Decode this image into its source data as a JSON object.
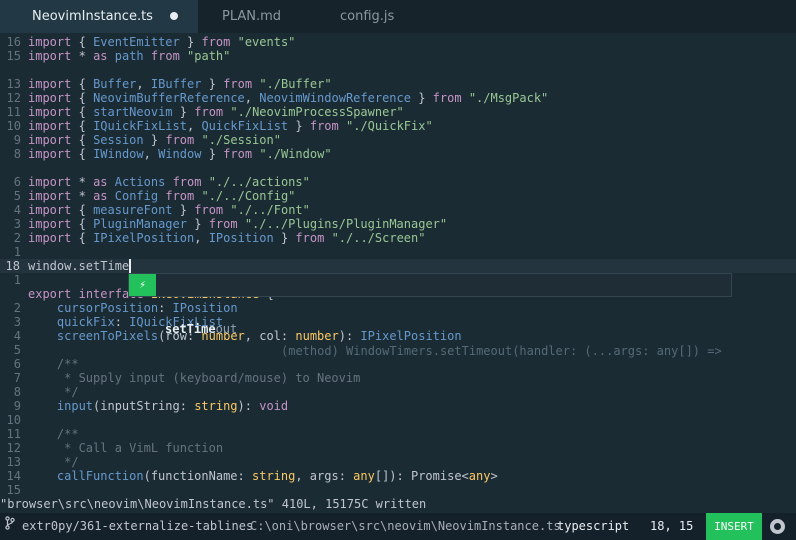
{
  "tabs": [
    {
      "label": "NeovimInstance.ts",
      "modified": true,
      "active": true
    },
    {
      "label": "PLAN.md"
    },
    {
      "label": "config.js"
    }
  ],
  "gutter": [
    "16",
    "15",
    "",
    "13",
    "12",
    "11",
    "10",
    "9",
    "8",
    "",
    "6",
    "5",
    "4",
    "3",
    "2",
    "1",
    "",
    "18",
    "1",
    "2",
    "3",
    "4",
    "5",
    "6",
    "7",
    "8",
    "9",
    "10",
    "11",
    "12",
    "13",
    "14",
    "15",
    "16"
  ],
  "code": {
    "l0": [
      "import",
      "{",
      "EventEmitter",
      "}",
      "from",
      "\"events\""
    ],
    "l1": [
      "import",
      "*",
      "as",
      "path",
      "from",
      "\"path\""
    ],
    "l3": [
      "import",
      "{",
      "Buffer",
      ",",
      "IBuffer",
      "}",
      "from",
      "\"./Buffer\""
    ],
    "l4": [
      "import",
      "{",
      "NeovimBufferReference",
      ",",
      "NeovimWindowReference",
      "}",
      "from",
      "\"./MsgPack\""
    ],
    "l5": [
      "import",
      "{",
      "startNeovim",
      "}",
      "from",
      "\"./NeovimProcessSpawner\""
    ],
    "l6": [
      "import",
      "{",
      "IQuickFixList",
      ",",
      "QuickFixList",
      "}",
      "from",
      "\"./QuickFix\""
    ],
    "l7": [
      "import",
      "{",
      "Session",
      "}",
      "from",
      "\"./Session\""
    ],
    "l8": [
      "import",
      "{",
      "IWindow",
      ",",
      "Window",
      "}",
      "from",
      "\"./Window\""
    ],
    "l10": [
      "import",
      "*",
      "as",
      "Actions",
      "from",
      "\"./../actions\""
    ],
    "l11": [
      "import",
      "*",
      "as",
      "Config",
      "from",
      "\"./../Config\""
    ],
    "l12": [
      "import",
      "{",
      "measureFont",
      "}",
      "from",
      "\"./../Font\""
    ],
    "l13": [
      "import",
      "{",
      "PluginManager",
      "}",
      "from",
      "\"./../Plugins/PluginManager\""
    ],
    "l14": [
      "import",
      "{",
      "IPixelPosition",
      ",",
      "IPosition",
      "}",
      "from",
      "\"./../Screen\""
    ],
    "l17": [
      "window.setTime"
    ],
    "l19": [
      "export",
      "interface",
      "INeovimInstance",
      "{"
    ],
    "l20": [
      "cursorPosition",
      ":",
      "IPosition"
    ],
    "l21": [
      "quickFix",
      ":",
      "IQuickFixList"
    ],
    "l22": [
      "screenToPixels",
      "(row:",
      "number",
      ", col:",
      "number",
      "):",
      "IPixelPosition"
    ],
    "l24": [
      "/**"
    ],
    "l25": [
      "* Supply input (keyboard/mouse) to Neovim"
    ],
    "l26": [
      "*/"
    ],
    "l27": [
      "input",
      "(inputString:",
      "string",
      "):",
      "void"
    ],
    "l29": [
      "/**"
    ],
    "l30": [
      "* Call a VimL function"
    ],
    "l31": [
      "*/"
    ],
    "l32": [
      "callFunction",
      "(functionName:",
      "string",
      ", args:",
      "any",
      "[]): Promise<",
      "any",
      ">"
    ]
  },
  "completion": {
    "icon": "⚡",
    "icon_name": "method-icon",
    "label_match": "setTime",
    "label_rest": "out",
    "detail": "(method) WindowTimers.setTimeout(handler: (...args: any[]) => void,..."
  },
  "message": "\"browser\\src\\neovim\\NeovimInstance.ts\" 410L, 15175C written",
  "status": {
    "branch_icon": "git-branch-icon",
    "branch": "extr0py/361-externalize-tablines",
    "path": "C:\\oni\\browser\\src\\neovim\\NeovimInstance.ts",
    "language": "typescript",
    "position": "18, 15",
    "mode": "INSERT",
    "github_icon": "github-icon"
  },
  "colors": {
    "background": "#1b2b34",
    "keyword": "#c594c5",
    "identifier": "#6699cc",
    "string": "#99c794",
    "comment": "#65737e",
    "type": "#fac863",
    "insert_mode": "#23c15c"
  }
}
